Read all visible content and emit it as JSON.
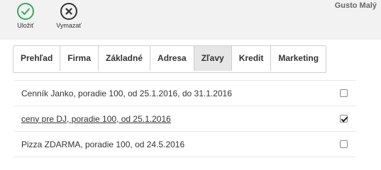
{
  "toolbar": {
    "save_label": "Uložiť",
    "clear_label": "Vymazať"
  },
  "user": {
    "name": "Gusto Malý"
  },
  "tabs": [
    {
      "label": "Prehľad",
      "active": false
    },
    {
      "label": "Firma",
      "active": false
    },
    {
      "label": "Základné",
      "active": false
    },
    {
      "label": "Adresa",
      "active": false
    },
    {
      "label": "Zľavy",
      "active": true
    },
    {
      "label": "Kredit",
      "active": false
    },
    {
      "label": "Marketing",
      "active": false
    }
  ],
  "discounts": [
    {
      "text": "Cenník Janko, poradie 100, od 25.1.2016, do 31.1.2016",
      "checked": false,
      "link": false
    },
    {
      "text": "ceny pre DJ, poradie 100, od 25.1.2016",
      "checked": true,
      "link": true
    },
    {
      "text": "Pizza ZDARMA, poradie 100, od 24.5.2016",
      "checked": false,
      "link": false
    }
  ],
  "colors": {
    "save_accent": "#38a85a",
    "active_tab_bg": "#e6e6e6",
    "topbar_bg": "#f2f2f2"
  },
  "icons": {
    "save": "check-circle-icon",
    "clear": "x-circle-icon"
  }
}
